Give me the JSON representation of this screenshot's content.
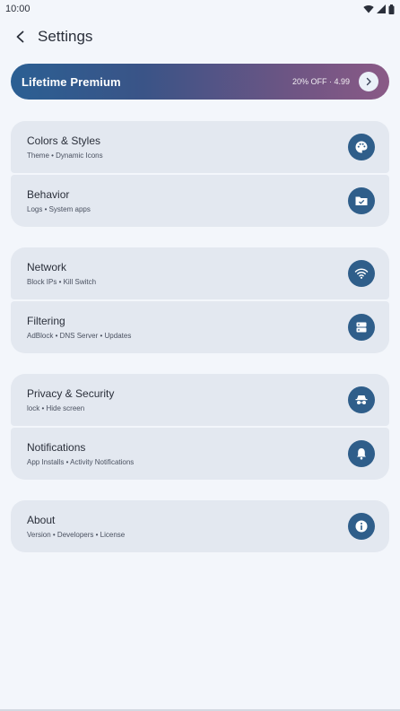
{
  "status": {
    "time": "10:00"
  },
  "header": {
    "title": "Settings"
  },
  "premium": {
    "title": "Lifetime Premium",
    "price": "20% OFF · 4.99"
  },
  "groups": [
    {
      "items": [
        {
          "title": "Colors & Styles",
          "subtitle": "Theme • Dynamic Icons",
          "icon": "palette-icon"
        },
        {
          "title": "Behavior",
          "subtitle": "Logs • System apps",
          "icon": "folder-check-icon"
        }
      ]
    },
    {
      "items": [
        {
          "title": "Network",
          "subtitle": "Block IPs • Kill Switch",
          "icon": "wifi-icon"
        },
        {
          "title": "Filtering",
          "subtitle": "AdBlock • DNS Server • Updates",
          "icon": "server-icon"
        }
      ]
    },
    {
      "items": [
        {
          "title": "Privacy & Security",
          "subtitle": "lock • Hide screen",
          "icon": "incognito-icon"
        },
        {
          "title": "Notifications",
          "subtitle": "App Installs • Activity Notifications",
          "icon": "bell-icon"
        }
      ]
    },
    {
      "items": [
        {
          "title": "About",
          "subtitle": "Version • Developers • License",
          "icon": "info-icon"
        }
      ]
    }
  ],
  "colors": {
    "accent": "#2f5e8a",
    "card": "#e3e8f0",
    "background": "#f3f6fb"
  }
}
